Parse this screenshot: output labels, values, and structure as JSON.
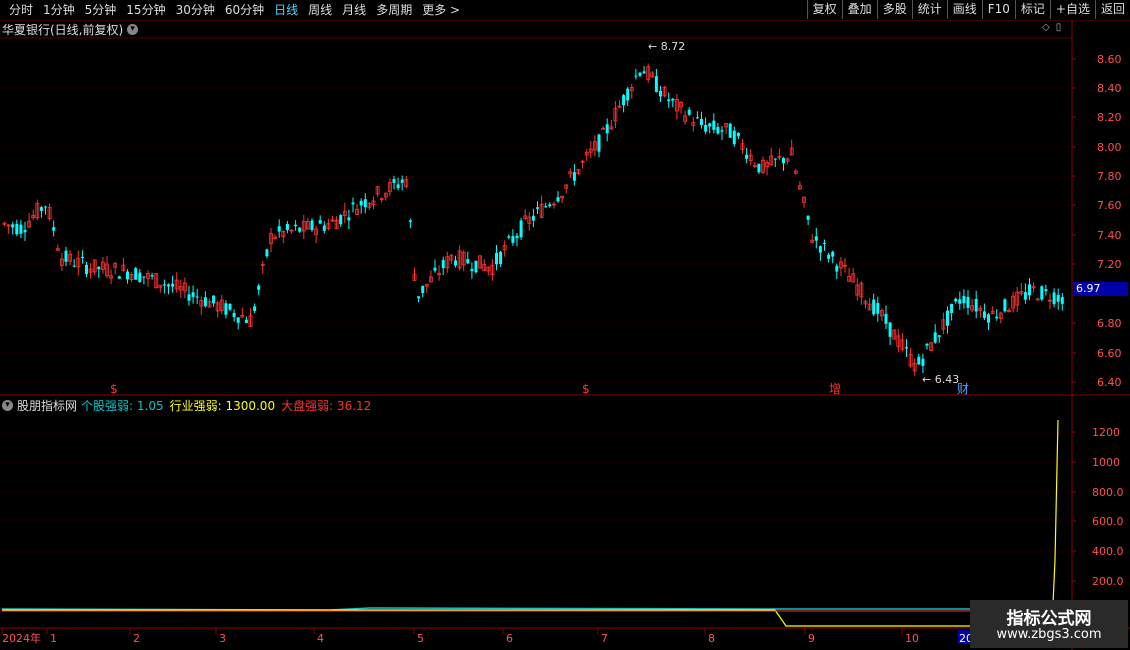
{
  "toolbar": {
    "left_items": [
      "分时",
      "1分钟",
      "5分钟",
      "15分钟",
      "30分钟",
      "60分钟",
      "日线",
      "周线",
      "月线",
      "多周期",
      "更多 >"
    ],
    "active_index": 6,
    "right_items": [
      "复权",
      "叠加",
      "多股",
      "统计",
      "画线",
      "F10",
      "标记",
      "+自选",
      "返回"
    ]
  },
  "main_chart": {
    "title": "华夏银行(日线,前复权)",
    "y_ticks": [
      "8.60",
      "8.40",
      "8.20",
      "8.00",
      "7.80",
      "7.60",
      "7.40",
      "7.20",
      "6.80",
      "6.60",
      "6.40"
    ],
    "current_price": "6.97",
    "high_label": "8.72",
    "low_label": "6.43",
    "markers": [
      "$",
      "$",
      "增",
      "财"
    ],
    "up_color": "#ff3232",
    "down_color": "#00ffff"
  },
  "indicator": {
    "name": "股朋指标网",
    "items": [
      {
        "label": "个股强弱:",
        "value": "1.05",
        "color": "#00c8c8"
      },
      {
        "label": "行业强弱:",
        "value": "1300.00",
        "color": "#ffff00"
      },
      {
        "label": "大盘强弱:",
        "value": "36.12",
        "color": "#ff3232"
      }
    ],
    "y_ticks": [
      "1200",
      "1000",
      "800.0",
      "600.0",
      "400.0",
      "200.0"
    ]
  },
  "x_axis": {
    "labels": [
      "2024年",
      "1",
      "2",
      "3",
      "4",
      "5",
      "6",
      "7",
      "8",
      "9",
      "10",
      "11",
      "20"
    ]
  },
  "watermark": {
    "line1": "指标公式网",
    "line2": "www.zbgs3.com"
  }
}
